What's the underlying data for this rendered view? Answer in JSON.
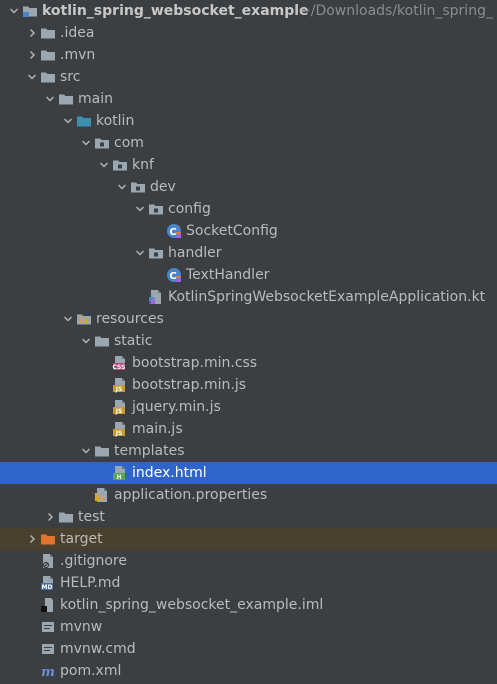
{
  "project": {
    "name": "kotlin_spring_websocket_example",
    "path": "~/Downloads/kotlin_spring_"
  },
  "rows": [
    {
      "id": "project-root",
      "label": "kotlin_spring_websocket_example",
      "depth": 0,
      "arrow": "down",
      "icon": "module-folder-icon",
      "bold": true,
      "path": true
    },
    {
      "id": "idea",
      "label": ".idea",
      "depth": 1,
      "arrow": "right",
      "icon": "folder-icon"
    },
    {
      "id": "mvn",
      "label": ".mvn",
      "depth": 1,
      "arrow": "right",
      "icon": "folder-icon"
    },
    {
      "id": "src",
      "label": "src",
      "depth": 1,
      "arrow": "down",
      "icon": "folder-icon"
    },
    {
      "id": "main",
      "label": "main",
      "depth": 2,
      "arrow": "down",
      "icon": "folder-icon"
    },
    {
      "id": "kotlin",
      "label": "kotlin",
      "depth": 3,
      "arrow": "down",
      "icon": "source-folder-icon"
    },
    {
      "id": "com",
      "label": "com",
      "depth": 4,
      "arrow": "down",
      "icon": "package-icon"
    },
    {
      "id": "knf",
      "label": "knf",
      "depth": 5,
      "arrow": "down",
      "icon": "package-icon"
    },
    {
      "id": "dev",
      "label": "dev",
      "depth": 6,
      "arrow": "down",
      "icon": "package-icon"
    },
    {
      "id": "config",
      "label": "config",
      "depth": 7,
      "arrow": "down",
      "icon": "package-icon"
    },
    {
      "id": "socketconfig",
      "label": "SocketConfig",
      "depth": 8,
      "arrow": "none",
      "icon": "kotlin-class-icon"
    },
    {
      "id": "handler",
      "label": "handler",
      "depth": 7,
      "arrow": "down",
      "icon": "package-icon"
    },
    {
      "id": "texthandler",
      "label": "TextHandler",
      "depth": 8,
      "arrow": "none",
      "icon": "kotlin-class-icon"
    },
    {
      "id": "application-kt",
      "label": "KotlinSpringWebsocketExampleApplication.kt",
      "depth": 7,
      "arrow": "none",
      "icon": "kotlin-file-icon"
    },
    {
      "id": "resources",
      "label": "resources",
      "depth": 3,
      "arrow": "down",
      "icon": "resources-folder-icon"
    },
    {
      "id": "static",
      "label": "static",
      "depth": 4,
      "arrow": "down",
      "icon": "folder-icon"
    },
    {
      "id": "bootstrap-css",
      "label": "bootstrap.min.css",
      "depth": 5,
      "arrow": "none",
      "icon": "css-file-icon"
    },
    {
      "id": "bootstrap-js",
      "label": "bootstrap.min.js",
      "depth": 5,
      "arrow": "none",
      "icon": "js-file-icon"
    },
    {
      "id": "jquery-js",
      "label": "jquery.min.js",
      "depth": 5,
      "arrow": "none",
      "icon": "js-file-icon"
    },
    {
      "id": "main-js",
      "label": "main.js",
      "depth": 5,
      "arrow": "none",
      "icon": "js-file-icon"
    },
    {
      "id": "templates",
      "label": "templates",
      "depth": 4,
      "arrow": "down",
      "icon": "folder-icon"
    },
    {
      "id": "index-html",
      "label": "index.html",
      "depth": 5,
      "arrow": "none",
      "icon": "html-file-icon",
      "selected": true
    },
    {
      "id": "application-properties",
      "label": "application.properties",
      "depth": 4,
      "arrow": "none",
      "icon": "properties-file-icon"
    },
    {
      "id": "test",
      "label": "test",
      "depth": 2,
      "arrow": "right",
      "icon": "folder-icon"
    },
    {
      "id": "target",
      "label": "target",
      "depth": 1,
      "arrow": "right",
      "icon": "excluded-folder-icon",
      "excluded": true
    },
    {
      "id": "gitignore",
      "label": ".gitignore",
      "depth": 1,
      "arrow": "none",
      "icon": "gitignore-file-icon"
    },
    {
      "id": "help-md",
      "label": "HELP.md",
      "depth": 1,
      "arrow": "none",
      "icon": "markdown-file-icon"
    },
    {
      "id": "iml",
      "label": "kotlin_spring_websocket_example.iml",
      "depth": 1,
      "arrow": "none",
      "icon": "iml-file-icon"
    },
    {
      "id": "mvnw",
      "label": "mvnw",
      "depth": 1,
      "arrow": "none",
      "icon": "text-file-icon"
    },
    {
      "id": "mvnw-cmd",
      "label": "mvnw.cmd",
      "depth": 1,
      "arrow": "none",
      "icon": "text-file-icon"
    },
    {
      "id": "pom-xml",
      "label": "pom.xml",
      "depth": 1,
      "arrow": "none",
      "icon": "maven-file-icon"
    }
  ],
  "colors": {
    "background": "#3c3f41",
    "selection": "#2f65ca",
    "excluded_row": "#49412d",
    "text": "#bbbbbb",
    "muted_text": "#8c8c8c",
    "folder": "#9aa7b0",
    "source_folder": "#3d8fb0",
    "excluded_folder": "#e0752d",
    "kotlin": "#4a86c7"
  }
}
